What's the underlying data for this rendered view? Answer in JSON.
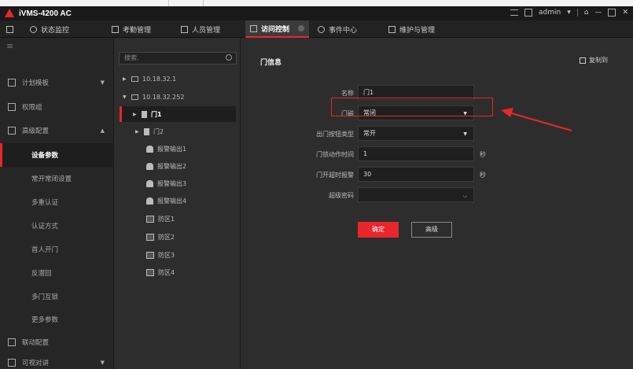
{
  "app": {
    "title": "iVMS-4200 AC",
    "user": "admin"
  },
  "nav": {
    "items": [
      {
        "label": "状态监控"
      },
      {
        "label": "考勤管理"
      },
      {
        "label": "人员管理"
      },
      {
        "label": "访问控制"
      },
      {
        "label": "事件中心"
      },
      {
        "label": "维护与管理"
      }
    ]
  },
  "sidebar": {
    "items": [
      {
        "label": "计划模板"
      },
      {
        "label": "权限组"
      },
      {
        "label": "高级配置"
      },
      {
        "label": "设备参数"
      },
      {
        "label": "常开常闭设置"
      },
      {
        "label": "多重认证"
      },
      {
        "label": "认证方式"
      },
      {
        "label": "首人开门"
      },
      {
        "label": "反潜回"
      },
      {
        "label": "多门互锁"
      },
      {
        "label": "更多参数"
      },
      {
        "label": "联动配置"
      },
      {
        "label": "可视对讲"
      }
    ]
  },
  "tree": {
    "search_placeholder": "搜索.",
    "nodes": [
      {
        "label": "10.18.32.1"
      },
      {
        "label": "10.18.32.252"
      },
      {
        "label": "门1"
      },
      {
        "label": "门2"
      },
      {
        "label": "报警输出1"
      },
      {
        "label": "报警输出2"
      },
      {
        "label": "报警输出3"
      },
      {
        "label": "报警输出4"
      },
      {
        "label": "防区1"
      },
      {
        "label": "防区2"
      },
      {
        "label": "防区3"
      },
      {
        "label": "防区4"
      }
    ]
  },
  "main": {
    "section_title": "门信息",
    "copy_to": "复制到",
    "fields": [
      {
        "label": "名称",
        "value": "门1",
        "unit": ""
      },
      {
        "label": "门磁",
        "value": "常闭",
        "unit": ""
      },
      {
        "label": "出门按钮类型",
        "value": "常开",
        "unit": ""
      },
      {
        "label": "门锁动作时间",
        "value": "1",
        "unit": "秒"
      },
      {
        "label": "门开超时报警",
        "value": "30",
        "unit": "秒"
      },
      {
        "label": "超级密码",
        "value": "",
        "unit": ""
      }
    ],
    "ok_button": "确定",
    "advanced_button": "高级"
  },
  "colors": {
    "accent": "#e8262c",
    "background": "#2d2d2d"
  }
}
